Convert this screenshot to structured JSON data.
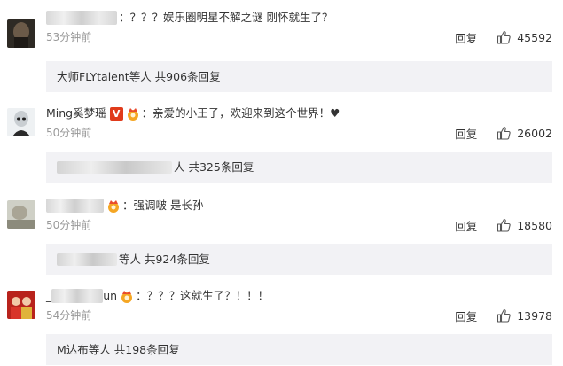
{
  "comments": [
    {
      "username": "",
      "badge_v": "",
      "text": "：？？？娱乐圈明星不解之谜 刚怀就生了？",
      "time": "53分钟前",
      "reply_label": "回复",
      "likes": "45592",
      "replies_summary": {
        "prefix": "大师FLYtalent",
        "suffix": " 等人 共906条回复"
      }
    },
    {
      "username": "Ming奚梦瑶",
      "badge_v": "V",
      "text": "：亲爱的小王子，欢迎来到这个世界！♥",
      "time": "50分钟前",
      "reply_label": "回复",
      "likes": "26002",
      "replies_summary": {
        "prefix": "",
        "suffix": "人 共325条回复"
      }
    },
    {
      "username": "",
      "badge_v": "",
      "text": "：强调啵 是长孙",
      "time": "50分钟前",
      "reply_label": "回复",
      "likes": "18580",
      "replies_summary": {
        "prefix": "",
        "suffix": "等人 共924条回复"
      }
    },
    {
      "username": "_",
      "username_tail": "un",
      "badge_v": "",
      "text": "：？？？这就生了？！！！",
      "time": "54分钟前",
      "reply_label": "回复",
      "likes": "13978",
      "replies_summary": {
        "prefix": "M达布",
        "suffix": " 等人 共198条回复"
      }
    }
  ],
  "colors": {
    "accent_red": "#e03b1b",
    "time_gray": "#999999",
    "reply_bg": "#f2f2f5"
  }
}
